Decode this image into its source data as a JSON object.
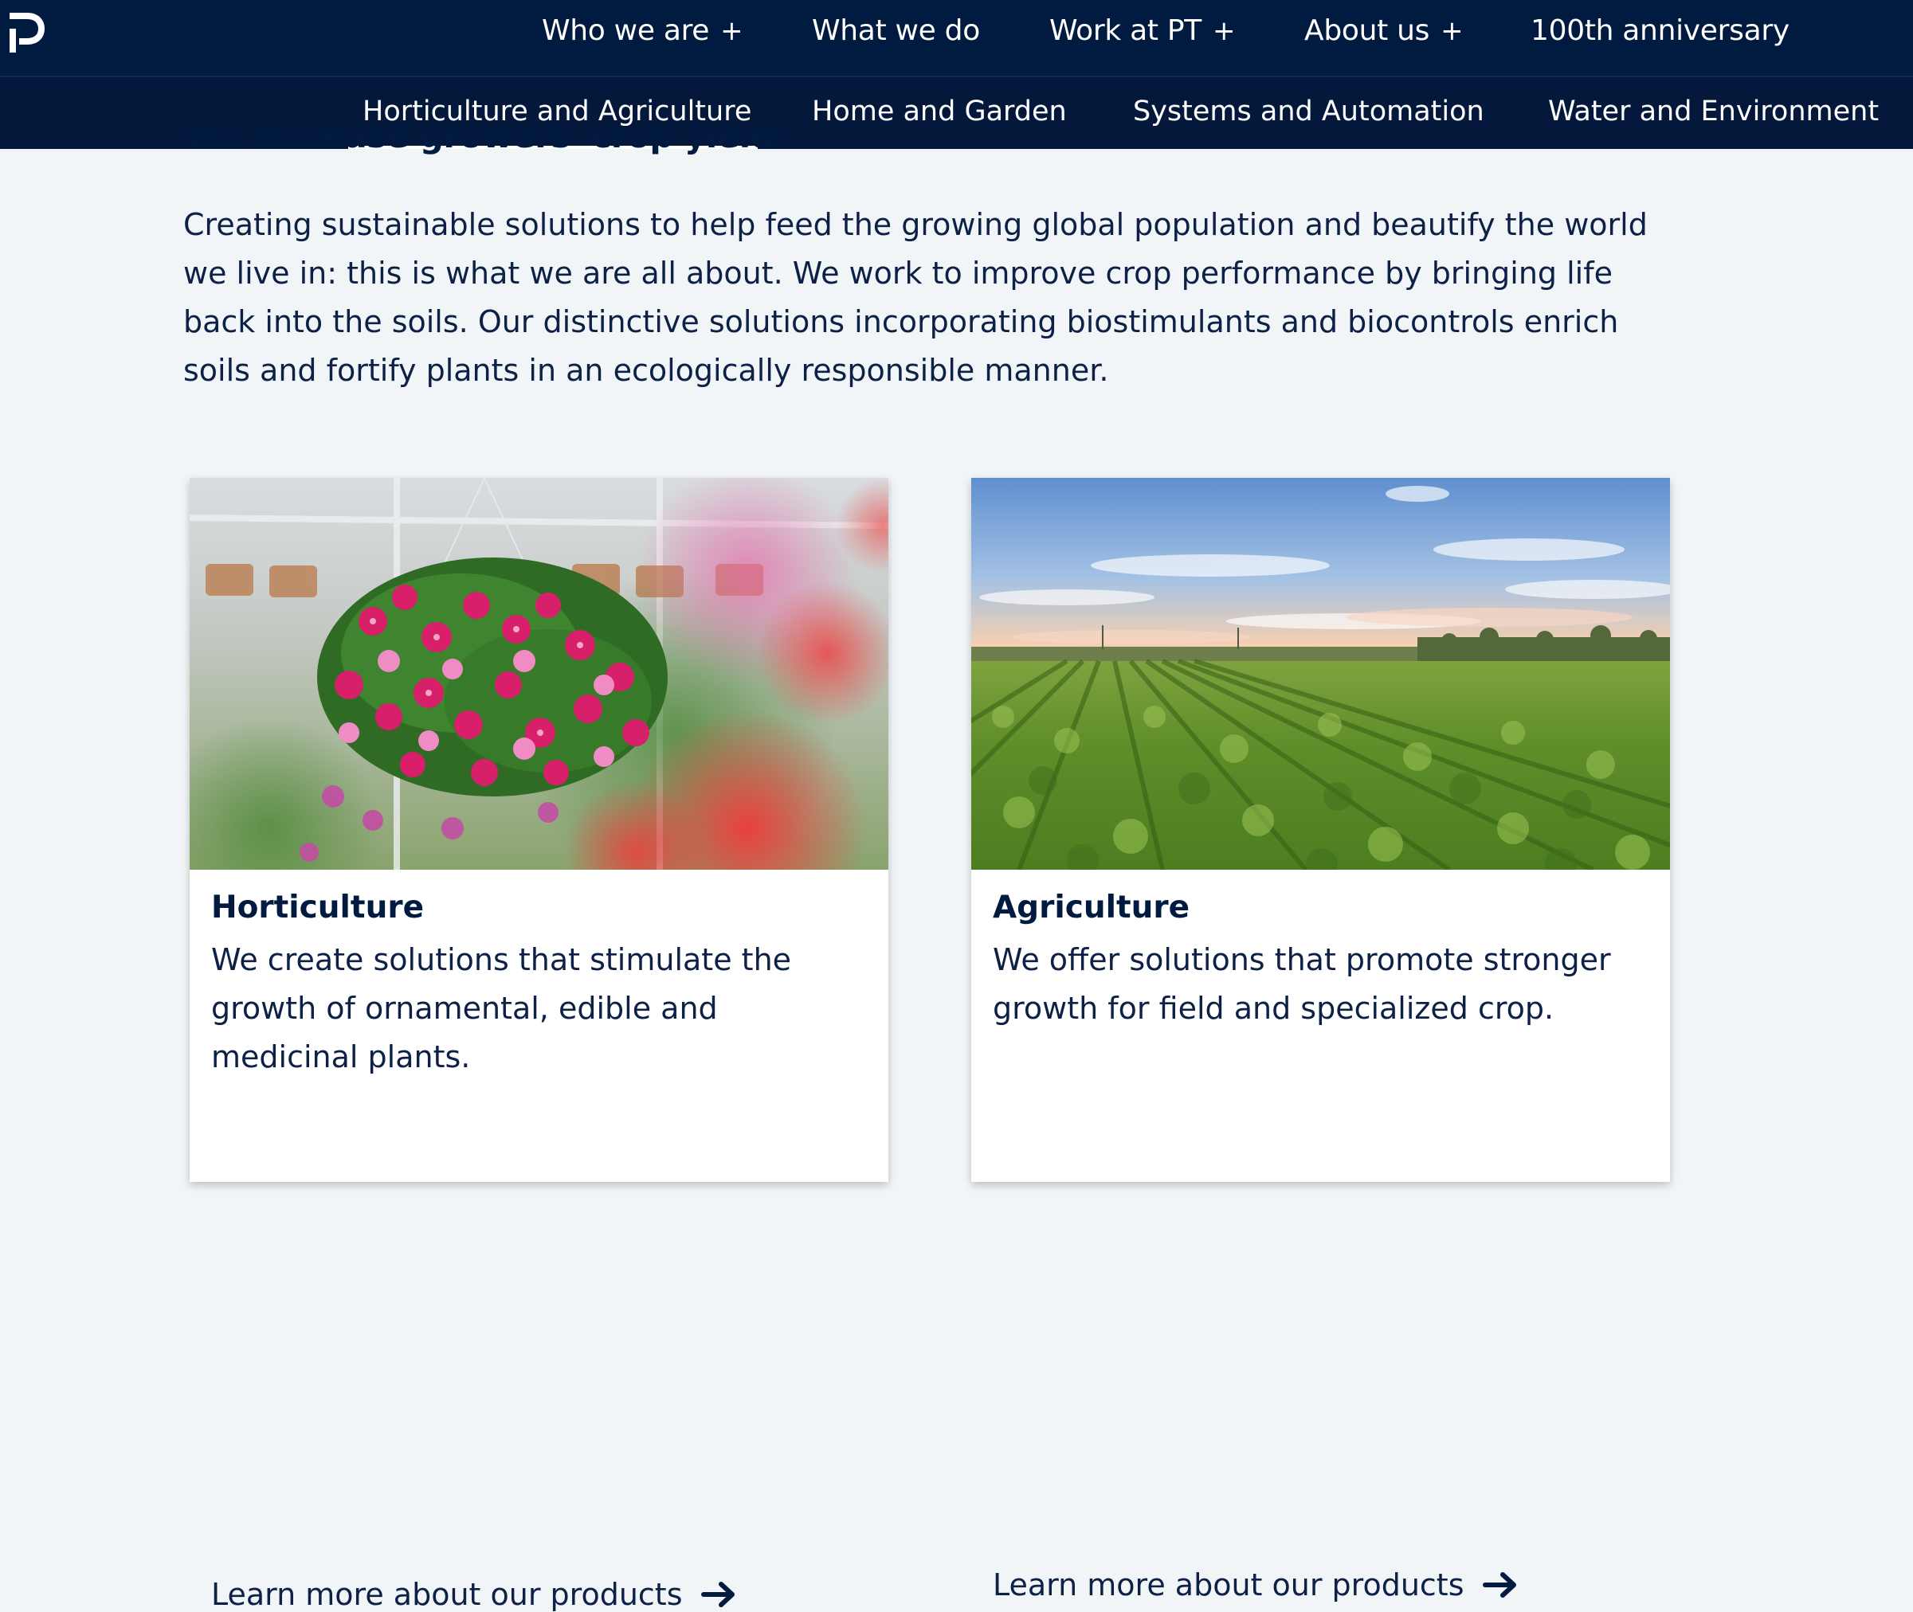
{
  "nav": {
    "items": [
      {
        "label": "Who we are",
        "has_plus": true
      },
      {
        "label": "What we do",
        "has_plus": false
      },
      {
        "label": "Work at PT",
        "has_plus": true
      },
      {
        "label": "About us",
        "has_plus": true
      },
      {
        "label": "100th anniversary",
        "has_plus": false
      }
    ],
    "plus_symbol": "+"
  },
  "subnav": {
    "items": [
      {
        "label": "Horticulture and Agriculture",
        "active": true
      },
      {
        "label": "Home and Garden",
        "active": false
      },
      {
        "label": "Systems and Automation",
        "active": false
      },
      {
        "label": "Water and Environment",
        "active": false
      }
    ]
  },
  "main": {
    "heading": "We increase growers' crop yields",
    "intro": "Creating sustainable solutions to help feed the growing global population and beautify the world we live in: this is what we are all about. We work to improve crop performance by bringing life back into the soils. Our distinctive solutions incorporating biostimulants and biocontrols enrich soils and fortify plants in an ecologically responsible manner."
  },
  "cards": [
    {
      "title": "Horticulture",
      "description": "We create solutions that stimulate the growth of ornamental, edible and medicinal plants.",
      "link": "Learn more about our products",
      "image": "hanging-flower-basket-photo"
    },
    {
      "title": "Agriculture",
      "description": "We offer solutions that promote stronger growth for field and specialized crop.",
      "link": "Learn more about our products",
      "image": "crop-field-photo"
    }
  ],
  "colors": {
    "navy": "#001b3f",
    "background": "#f1f5f8",
    "text": "#0d2147"
  }
}
